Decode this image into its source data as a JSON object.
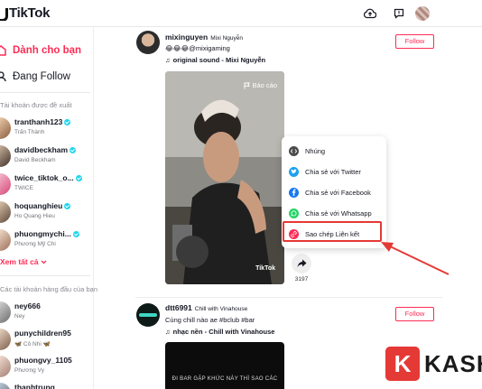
{
  "header": {
    "logo_text": "TikTok"
  },
  "sidebar": {
    "nav": [
      {
        "label": "Dành cho bạn"
      },
      {
        "label": "Đang Follow"
      }
    ],
    "suggested_heading": "Tài khoản được đề xuất",
    "suggested": [
      {
        "name": "tranthanh123",
        "sub": "Trấn Thành",
        "verified": true
      },
      {
        "name": "davidbeckham",
        "sub": "David Beckham",
        "verified": true
      },
      {
        "name": "twice_tiktok_o...",
        "sub": "TWICE",
        "verified": true
      },
      {
        "name": "hoquanghieu",
        "sub": "Ho Quang Hieu",
        "verified": true
      },
      {
        "name": "phuongmychi...",
        "sub": "Phương Mỹ Chi",
        "verified": true
      }
    ],
    "see_all": "Xem tất cả",
    "following_heading": "Các tài khoản hàng đầu của bạn",
    "following": [
      {
        "name": "ney666",
        "sub": "Ney"
      },
      {
        "name": "punychildren95",
        "sub": "🦋 Cô Nhi 🦋"
      },
      {
        "name": "phuongvy_1105",
        "sub": "Phương Vy"
      },
      {
        "name": "thanhtrung",
        "sub": ""
      }
    ]
  },
  "posts": [
    {
      "username": "mixinguyen",
      "display_name": "Mixi Nguyễn",
      "caption": "😂😂😂@mixigaming",
      "sound": "original sound - Mixi Nguyễn",
      "follow_label": "Follow",
      "report_label": "Báo cáo",
      "watermark": "TikTok",
      "share_count": "3197"
    },
    {
      "username": "dtt6991",
      "display_name": "Chill with Vinahouse",
      "caption": "Cùng chill nào ae #bclub #bar",
      "sound": "nhạc nền - Chill with Vinahouse",
      "follow_label": "Follow",
      "video_text": "ĐI BAR GẶP KHỨC NÀY THÌ SAO CÁC"
    }
  ],
  "share_menu": {
    "items": [
      {
        "label": "Nhúng",
        "icon": "embed-icon",
        "color": "#4b4b4b"
      },
      {
        "label": "Chia sẻ với Twitter",
        "icon": "twitter-icon",
        "color": "#1da1f2"
      },
      {
        "label": "Chia sẻ với Facebook",
        "icon": "facebook-icon",
        "color": "#1877f2"
      },
      {
        "label": "Chia sẻ với Whatsapp",
        "icon": "whatsapp-icon",
        "color": "#25d366"
      },
      {
        "label": "Sao chép Liên kết",
        "icon": "link-icon",
        "color": "#fe2c55"
      }
    ]
  },
  "watermark": {
    "letter": "K",
    "text": "KASH"
  },
  "colors": {
    "accent": "#fe2c55",
    "annotation": "#e53935"
  }
}
